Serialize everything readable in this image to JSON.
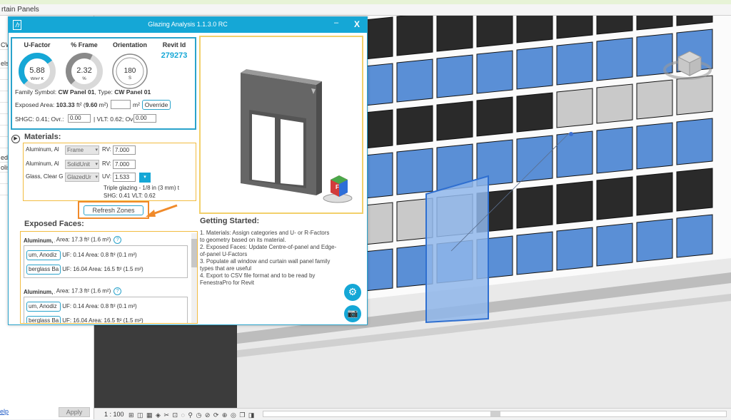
{
  "ribbon": {
    "tab": "rtain Panels"
  },
  "left_panel": {
    "rows": [
      "CW",
      "els (",
      "",
      "",
      "",
      "",
      "",
      "",
      "",
      "ed",
      "olis",
      "",
      ""
    ],
    "help": "elp",
    "apply": "Apply"
  },
  "status_bar": {
    "scale": "1 : 100",
    "icons": "⊞ ◫ ▦ ◈ ✂ ⊡ ◌ ⚲ ◷ ⊘ ⟳ ⊕ ◎ ❐ ◨"
  },
  "dialog": {
    "title": "Glazing Analysis 1.1.3.0 RC",
    "minimize": "–",
    "close": "X",
    "logo": "ℎ",
    "gauges": [
      {
        "label": "U-Factor",
        "value": "5.88",
        "unit": "W/m² K",
        "fill": 0.7
      },
      {
        "label": "% Frame",
        "value": "2.32",
        "unit": "%",
        "fill": 0.6
      },
      {
        "label": "Orientation",
        "value": "180",
        "unit": "S",
        "fill": 1.0
      }
    ],
    "revit_id_label": "Revit Id",
    "revit_id": "279273",
    "family_symbol": {
      "prefix": "Family Symbol: ",
      "symbol": "CW Panel 01",
      "mid": ", Type: ",
      "type": "CW Panel 01"
    },
    "exposed_area": {
      "prefix": "Exposed Area: ",
      "ft2": "103.33",
      "ft2_unit": " ft² (",
      "m2": "9.60",
      "m2_unit": " m²)",
      "input_unit": "m²",
      "override": "Override"
    },
    "shgc_line": {
      "shgc_label": "SHGC: 0.41; Ovr.:",
      "shgc_ovr": "0.00",
      "vlt_label": "| VLT: 0.62; Ovr.:",
      "vlt_ovr": "0.00"
    },
    "materials_title": "Materials:",
    "materials": [
      {
        "name": "Aluminum, Al",
        "category": "Frame",
        "prop": "RV:",
        "value": "7.000"
      },
      {
        "name": "Aluminum, Al",
        "category": "SolidUnit",
        "prop": "RV:",
        "value": "7.000"
      },
      {
        "name": "Glass, Clear G",
        "category": "GlazedUr",
        "prop": "UV:",
        "value": "1.533"
      }
    ],
    "uv_dropdown_icon": "▾",
    "material_note": "Triple glazing - 1/8 in (3 mm) t",
    "material_note2": "SHG: 0.41 VLT: 0.62",
    "refresh": "Refresh Zones",
    "faces_title": "Exposed Faces:",
    "faces": [
      {
        "head": "Aluminum, A",
        "area": "Area: 17.3 ft² (1.6 m²)",
        "rows": [
          {
            "name": "um, Anodiz",
            "uf": "UF: 0.14",
            "area": "Area: 0.8 ft² (0.1 m²)"
          },
          {
            "name": "berglass Ba",
            "uf": "UF: 16.04",
            "area": "Area: 16.5 ft² (1.5 m²)"
          }
        ]
      },
      {
        "head": "Aluminum, A",
        "area": "Area: 17.3 ft² (1.6 m²)",
        "rows": [
          {
            "name": "um, Anodiz",
            "uf": "UF: 0.14",
            "area": "Area: 0.8 ft² (0.1 m²)"
          },
          {
            "name": "berglass Ba",
            "uf": "UF: 16.04",
            "area": "Area: 16.5 ft² (1.5 m²)"
          }
        ]
      }
    ],
    "help_icon": "?",
    "getting_started_title": "Getting Started:",
    "getting_started": [
      "1. Materials: Assign categories and U- or R-Factors",
      "to geometry based on its material.",
      "2. Exposed Faces: Update Centre-of-panel and Edge-",
      "of-panel U-Factors",
      "3. Populate all window and curtain wall panel family",
      "types that are useful",
      "4. Export to CSV file format and to be read by",
      "FenestraPro for Revit"
    ],
    "settings_icon": "⚙",
    "camera_icon": "📷"
  },
  "colors": {
    "accent": "#15a7d6",
    "highlight": "#f08a2a",
    "glass": "#5a8fd6",
    "selected": "#8fb6ea"
  }
}
